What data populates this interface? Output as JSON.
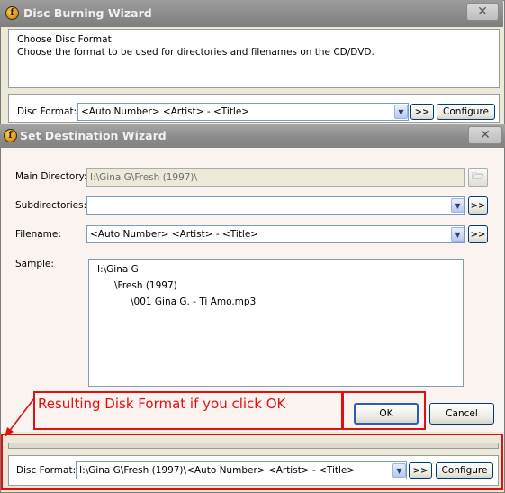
{
  "disc_burning_wizard": {
    "title": "Disc Burning Wizard",
    "close_glyph": "✕",
    "heading": "Choose Disc Format",
    "description": "Choose the format to be used for directories and filenames on the CD/DVD.",
    "disc_format_label": "Disc Format:",
    "disc_format_value": "<Auto Number> <Artist> - <Title>",
    "insert_button": ">>",
    "configure_button": "Configure"
  },
  "set_destination_wizard": {
    "title": "Set Destination Wizard",
    "close_glyph": "✕",
    "main_directory_label": "Main Directory:",
    "main_directory_value": "I:\\Gina G\\Fresh (1997)\\",
    "subdirectories_label": "Subdirectories:",
    "subdirectories_value": "",
    "filename_label": "Filename:",
    "filename_value": "<Auto Number> <Artist> - <Title>",
    "insert_button": ">>",
    "sample_label": "Sample:",
    "sample_lines": [
      "I:\\Gina G",
      "\\Fresh (1997)",
      "\\001 Gina G. - Ti Amo.mp3"
    ],
    "ok_button": "OK",
    "cancel_button": "Cancel"
  },
  "annotation": {
    "callout_text": "Resulting Disk Format if you click OK",
    "color": "#e01010"
  },
  "result_panel": {
    "disc_format_label": "Disc Format:",
    "disc_format_value": "I:\\Gina G\\Fresh (1997)\\<Auto Number> <Artist> - <Title>",
    "insert_button": ">>",
    "configure_button": "Configure"
  },
  "icons": {
    "app_logo": "app-logo-icon",
    "dropdown": "chevron-down-icon",
    "folder": "folder-open-icon",
    "close": "close-icon"
  },
  "dropdown_glyph": "▼",
  "folder_glyph": "🗁",
  "logo_glyph": "f"
}
